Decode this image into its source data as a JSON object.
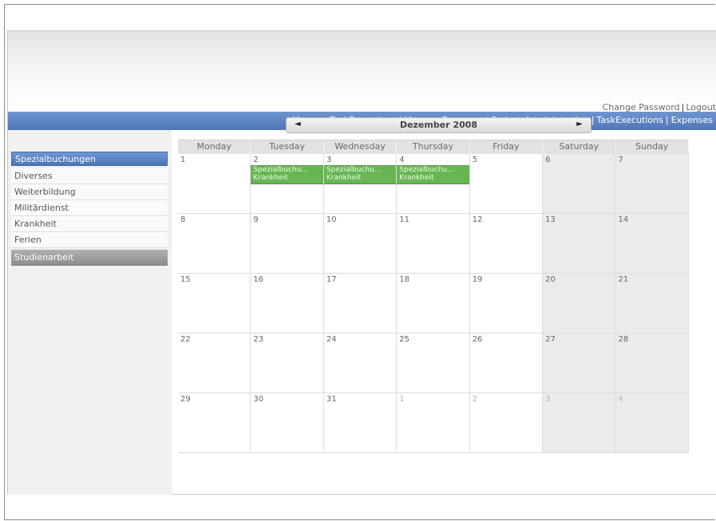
{
  "header": {
    "user_links": [
      "Change Password",
      "Logout"
    ],
    "nav_links": [
      "Manage TaskExecutions",
      "Manage Expenses",
      "Project-Administration",
      "TaskExecutions",
      "Expenses"
    ]
  },
  "sidebar": {
    "title": "Spezialbuchungen",
    "items": [
      "Diverses",
      "Weiterbildung",
      "Militärdienst",
      "Krankheit",
      "Ferien"
    ],
    "active_item": "Studienarbeit"
  },
  "calendar": {
    "month_title": "Dezember 2008",
    "prev_icon": "◄",
    "next_icon": "►",
    "day_names": [
      "Monday",
      "Tuesday",
      "Wednesday",
      "Thursday",
      "Friday",
      "Saturday",
      "Sunday"
    ],
    "weeks": [
      [
        {
          "d": "1"
        },
        {
          "d": "2"
        },
        {
          "d": "3"
        },
        {
          "d": "4"
        },
        {
          "d": "5"
        },
        {
          "d": "6"
        },
        {
          "d": "7"
        }
      ],
      [
        {
          "d": "8"
        },
        {
          "d": "9"
        },
        {
          "d": "10"
        },
        {
          "d": "11"
        },
        {
          "d": "12"
        },
        {
          "d": "13"
        },
        {
          "d": "14"
        }
      ],
      [
        {
          "d": "15"
        },
        {
          "d": "16"
        },
        {
          "d": "17"
        },
        {
          "d": "18"
        },
        {
          "d": "19"
        },
        {
          "d": "20"
        },
        {
          "d": "21"
        }
      ],
      [
        {
          "d": "22"
        },
        {
          "d": "23"
        },
        {
          "d": "24"
        },
        {
          "d": "25"
        },
        {
          "d": "26"
        },
        {
          "d": "27"
        },
        {
          "d": "28"
        }
      ],
      [
        {
          "d": "29"
        },
        {
          "d": "30"
        },
        {
          "d": "31"
        },
        {
          "d": "1",
          "other": true
        },
        {
          "d": "2",
          "other": true
        },
        {
          "d": "3",
          "other": true
        },
        {
          "d": "4",
          "other": true
        }
      ]
    ],
    "events": [
      {
        "day": "2",
        "line1": "Spezialbuchu...",
        "line2": "Krankheit"
      },
      {
        "day": "3",
        "line1": "Spezialbuchu...",
        "line2": "Krankheit"
      },
      {
        "day": "4",
        "line1": "Spezialbuchu...",
        "line2": "Krankheit"
      }
    ]
  },
  "colors": {
    "nav_blue": "#4f77b9",
    "event_green": "#67b653",
    "weekend_gray": "#ebebeb"
  }
}
